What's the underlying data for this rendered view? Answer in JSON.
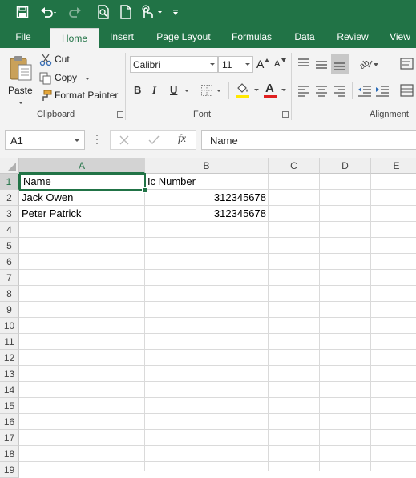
{
  "colors": {
    "brand": "#217346",
    "ribbon_bg": "#f3f3f3",
    "font_color_bar": "#e02020",
    "fill_color_bar": "#ffe800"
  },
  "qat": {
    "icons": [
      "save-icon",
      "undo-icon",
      "redo-icon",
      "print-preview-icon",
      "new-document-icon",
      "touch-mode-icon",
      "customize-toolbar-icon"
    ]
  },
  "tabs": [
    {
      "label": "File"
    },
    {
      "label": "Home"
    },
    {
      "label": "Insert"
    },
    {
      "label": "Page Layout"
    },
    {
      "label": "Formulas"
    },
    {
      "label": "Data"
    },
    {
      "label": "Review"
    },
    {
      "label": "View"
    }
  ],
  "ribbon": {
    "clipboard": {
      "paste_label": "Paste",
      "cut_label": "Cut",
      "copy_label": "Copy",
      "format_painter_label": "Format Painter",
      "group_label": "Clipboard"
    },
    "font": {
      "font_name": "Calibri",
      "font_size": "11",
      "group_label": "Font",
      "bold": "B",
      "italic": "I",
      "underline": "U",
      "font_color_letter": "A"
    },
    "alignment": {
      "group_label": "Alignment"
    }
  },
  "formula_bar": {
    "name_box": "A1",
    "fx_label": "fx",
    "formula_value": "Name"
  },
  "sheet": {
    "columns": [
      "A",
      "B",
      "C",
      "D",
      "E"
    ],
    "rows": [
      "1",
      "2",
      "3",
      "4",
      "5",
      "6",
      "7",
      "8",
      "9",
      "10",
      "11",
      "12",
      "13",
      "14",
      "15",
      "16",
      "17",
      "18",
      "19"
    ],
    "cells": {
      "a1": "Name",
      "b1": "Ic Number",
      "a2": "Jack Owen",
      "b2": "312345678",
      "a3": "Peter Patrick",
      "b3": "312345678"
    },
    "active_cell": "A1"
  }
}
